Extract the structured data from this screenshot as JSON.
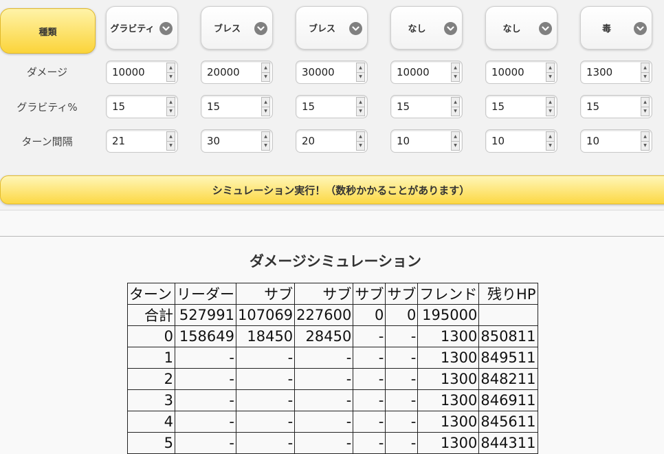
{
  "panel": {
    "type_label": "種類",
    "slots": [
      {
        "type": "グラビティ",
        "damage": "10000",
        "gravity": "15",
        "interval": "21"
      },
      {
        "type": "ブレス",
        "damage": "20000",
        "gravity": "15",
        "interval": "30"
      },
      {
        "type": "ブレス",
        "damage": "30000",
        "gravity": "15",
        "interval": "20"
      },
      {
        "type": "なし",
        "damage": "10000",
        "gravity": "15",
        "interval": "10"
      },
      {
        "type": "なし",
        "damage": "10000",
        "gravity": "15",
        "interval": "10"
      },
      {
        "type": "毒",
        "damage": "1300",
        "gravity": "15",
        "interval": "10"
      }
    ],
    "row_labels": {
      "damage": "ダメージ",
      "gravity": "グラビティ%",
      "interval": "ターン間隔"
    },
    "run_button": "シミュレーション実行！（数秒かかることがあります）"
  },
  "simulation": {
    "title": "ダメージシミュレーション",
    "headers": [
      "ターン",
      "リーダー",
      "サブ",
      "サブ",
      "サブ",
      "サブ",
      "フレンド",
      "残りHP"
    ],
    "rows": [
      [
        "合計",
        "527991",
        "107069",
        "227600",
        "0",
        "0",
        "195000",
        ""
      ],
      [
        "0",
        "158649",
        "18450",
        "28450",
        "-",
        "-",
        "1300",
        "850811"
      ],
      [
        "1",
        "-",
        "-",
        "-",
        "-",
        "-",
        "1300",
        "849511"
      ],
      [
        "2",
        "-",
        "-",
        "-",
        "-",
        "-",
        "1300",
        "848211"
      ],
      [
        "3",
        "-",
        "-",
        "-",
        "-",
        "-",
        "1300",
        "846911"
      ],
      [
        "4",
        "-",
        "-",
        "-",
        "-",
        "-",
        "1300",
        "845611"
      ],
      [
        "5",
        "-",
        "-",
        "-",
        "-",
        "-",
        "1300",
        "844311"
      ]
    ]
  }
}
